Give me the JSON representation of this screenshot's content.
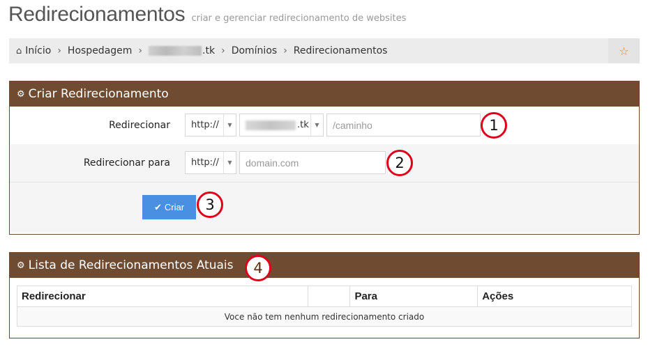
{
  "header": {
    "title": "Redirecionamentos",
    "subtitle": "criar e gerenciar redirecionamento de websites"
  },
  "breadcrumb": {
    "items": [
      {
        "label": "Início",
        "icon": "home-icon"
      },
      {
        "label": "Hospedagem"
      },
      {
        "label": ".tk",
        "redacted": true
      },
      {
        "label": "Domínios"
      },
      {
        "label": "Redirecionamentos"
      }
    ],
    "star_icon": "star-icon"
  },
  "create_panel": {
    "title": "Criar Redirecionamento",
    "icon": "cogs-icon",
    "redirect_label": "Redirecionar",
    "redirect_protocol": "http://",
    "redirect_domain": ".tk",
    "redirect_path_placeholder": "/caminho",
    "target_label": "Redirecionar para",
    "target_protocol": "http://",
    "target_placeholder": "domain.com",
    "submit_label": "Criar"
  },
  "list_panel": {
    "title": "Lista de Redirecionamentos Atuais",
    "icon": "cogs-icon",
    "columns": [
      "Redirecionar",
      "",
      "Para",
      "Ações"
    ],
    "empty_message": "Voce não tem nenhum redirecionamento criado"
  },
  "annotations": [
    "1",
    "2",
    "3",
    "4"
  ],
  "colors": {
    "panel_header": "#6f4c31",
    "button_primary": "#4a90e2",
    "marker": "#e0001a",
    "star": "#e08a33"
  }
}
